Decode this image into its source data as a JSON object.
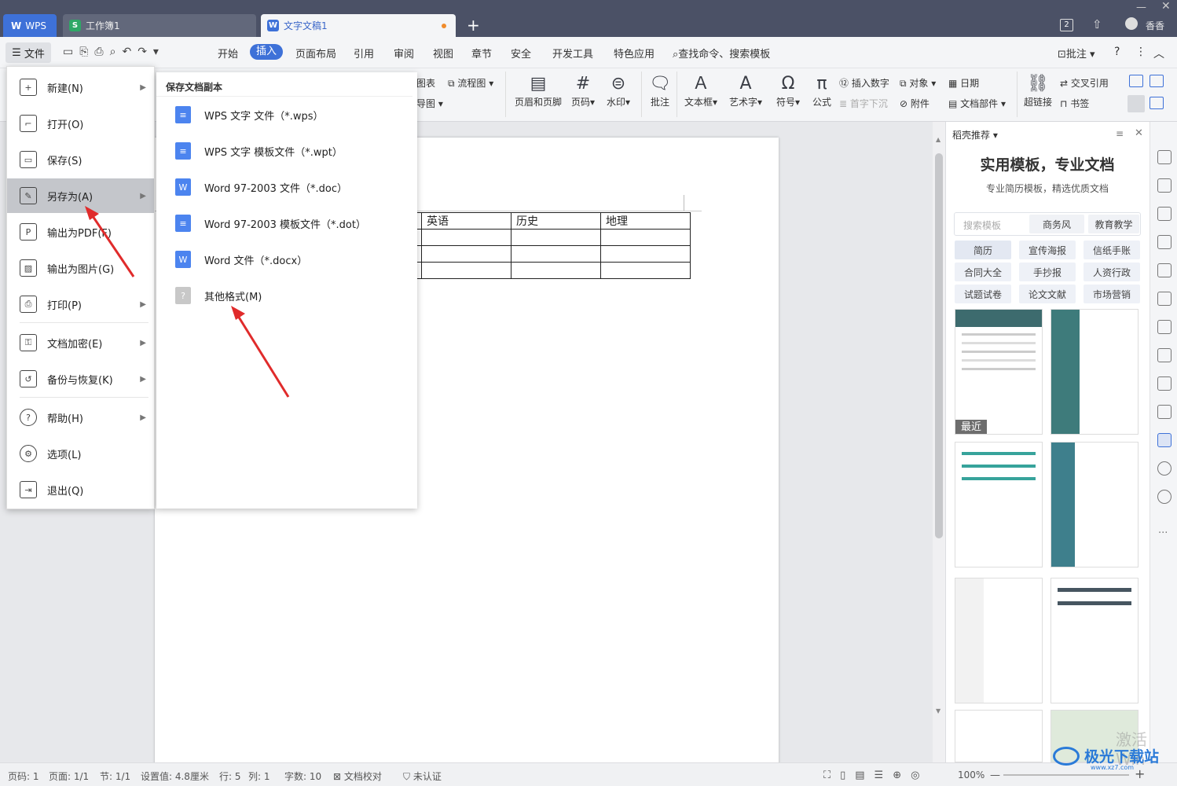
{
  "tabs": {
    "wps": "WPS",
    "workbook": "工作簿1",
    "document": "文字文稿1",
    "new_tab": "+"
  },
  "titlebar": {
    "badge": "2",
    "user": "香香"
  },
  "menubar": {
    "file": "文件",
    "items": [
      "开始",
      "插入",
      "页面布局",
      "引用",
      "审阅",
      "视图",
      "章节",
      "安全",
      "开发工具",
      "特色应用"
    ],
    "active": "插入",
    "search": "查找命令、搜索模板",
    "comment": "批注"
  },
  "ribbon": {
    "partial1": "图表",
    "partial2": "导图",
    "flowchart": "流程图",
    "header_footer": "页眉和页脚",
    "page_num": "页码",
    "watermark": "水印",
    "comment": "批注",
    "textbox": "文本框",
    "art_text": "艺术字",
    "symbol": "符号",
    "formula": "公式",
    "insert_number": "插入数字",
    "first_sink": "首字下沉",
    "object": "对象",
    "attachment": "附件",
    "date": "日期",
    "doc_part": "文档部件",
    "hyperlink": "超链接",
    "cross_ref": "交叉引用",
    "bookmark": "书签"
  },
  "file_menu": [
    {
      "label": "新建(N)",
      "icon": "new-icon",
      "arrow": true
    },
    {
      "label": "打开(O)",
      "icon": "open-icon",
      "arrow": false
    },
    {
      "label": "保存(S)",
      "icon": "save-icon",
      "arrow": false
    },
    {
      "label": "另存为(A)",
      "icon": "save-as-icon",
      "arrow": true
    },
    {
      "label": "输出为PDF(F)",
      "icon": "pdf-icon",
      "arrow": false
    },
    {
      "label": "输出为图片(G)",
      "icon": "image-icon",
      "arrow": false
    },
    {
      "label": "打印(P)",
      "icon": "print-icon",
      "arrow": true
    },
    {
      "label": "文档加密(E)",
      "icon": "encrypt-icon",
      "arrow": true
    },
    {
      "label": "备份与恢复(K)",
      "icon": "backup-icon",
      "arrow": true
    },
    {
      "label": "帮助(H)",
      "icon": "help-icon",
      "arrow": true
    },
    {
      "label": "选项(L)",
      "icon": "gear-icon",
      "arrow": false
    },
    {
      "label": "退出(Q)",
      "icon": "exit-icon",
      "arrow": false
    }
  ],
  "submenu": {
    "title": "保存文档副本",
    "items": [
      {
        "label": "WPS 文字 文件（*.wps）",
        "type": "wps"
      },
      {
        "label": "WPS 文字 模板文件（*.wpt）",
        "type": "wps"
      },
      {
        "label": "Word 97-2003 文件（*.doc）",
        "type": "word"
      },
      {
        "label": "Word 97-2003 模板文件（*.dot）",
        "type": "wps"
      },
      {
        "label": "Word 文件（*.docx）",
        "type": "word"
      },
      {
        "label": "其他格式(M)",
        "type": "other"
      }
    ]
  },
  "document": {
    "headers": [
      "英语",
      "历史",
      "地理"
    ]
  },
  "pane": {
    "title": "稻壳推荐",
    "heading": "实用模板，专业文档",
    "subheading": "专业简历模板，精选优质文档",
    "search_placeholder": "搜索模板",
    "quick_tags": [
      "商务风",
      "教育教学"
    ],
    "tags": [
      "简历",
      "宣传海报",
      "信纸手账",
      "合同大全",
      "手抄报",
      "人资行政",
      "试题试卷",
      "论文文献",
      "市场营销"
    ],
    "recent": "最近"
  },
  "status": {
    "page": "页码: 1",
    "pages": "页面: 1/1",
    "section": "节: 1/1",
    "setting": "设置值: 4.8厘米",
    "row": "行: 5",
    "col": "列: 1",
    "words": "字数: 10",
    "proof": "文档校对",
    "cert": "未认证",
    "zoom": "100%"
  },
  "watermark": {
    "text": "极光下载站",
    "url": "www.xz7.com",
    "faded": "激活 Win"
  },
  "colors": {
    "accent": "#3e71d8",
    "arrow": "#e02b2b"
  }
}
